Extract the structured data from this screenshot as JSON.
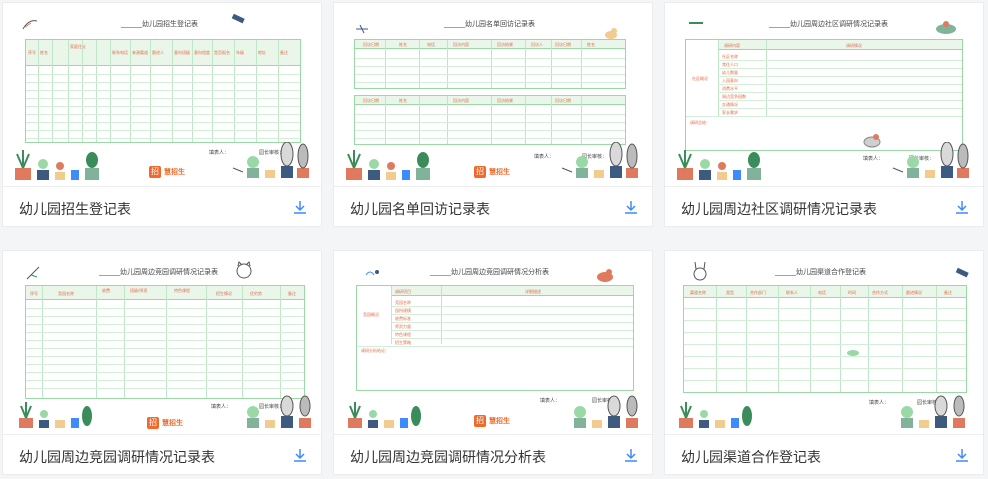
{
  "cards": [
    {
      "title": "幼儿园招生登记表",
      "doc_title": "______幼儿园招生登记表",
      "headers": [
        "序号",
        "姓名",
        "性别",
        "家庭住址",
        "联系电话",
        "来源渠道",
        "意向班级",
        "跟进人",
        "备注",
        "意向程度",
        "是否报名",
        "年级",
        "地址"
      ],
      "sig_left": "填表人：",
      "sig_right": "园长审核：",
      "brand": "慧招生"
    },
    {
      "title": "幼儿园名单回访记录表",
      "doc_title": "______幼儿园名单回访记录表",
      "headers": [
        "回访日期",
        "姓名",
        "电话",
        "回访内容",
        "回访结果",
        "回访人",
        "回访日期",
        "姓名",
        "电话",
        "回访内容"
      ],
      "sig_left": "填表人：",
      "sig_right": "园长审核：",
      "brand": "慧招生"
    },
    {
      "title": "幼儿园周边社区调研情况记录表",
      "doc_title": "______幼儿园周边社区调研情况记录表",
      "headers": [
        "调研内容",
        "调研情况"
      ],
      "rows": [
        "社区名称",
        "常住人口",
        "幼儿数量",
        "入园意向",
        "消费水平",
        "周边竞争园数",
        "交通情况",
        "家长需求",
        "其他"
      ],
      "side_label": "社区概况",
      "note_label": "调研总结：",
      "sig_left": "填表人：",
      "sig_right": "园长审核："
    },
    {
      "title": "幼儿园周边竞园调研情况记录表",
      "doc_title": "______幼儿园周边竞园调研情况记录表",
      "headers": [
        "序号",
        "竞园名称",
        "收费",
        "班级/师资",
        "特色课程",
        "招生情况",
        "优劣势",
        "备注"
      ],
      "sig_left": "填表人：",
      "sig_right": "园长审核：",
      "brand": "慧招生"
    },
    {
      "title": "幼儿园周边竞园调研情况分析表",
      "doc_title": "______幼儿园周边竞园调研情况分析表",
      "headers": [
        "调研项目",
        "详细描述"
      ],
      "rows": [
        "竞园名称",
        "园所规模",
        "收费标准",
        "师资力量",
        "特色课程",
        "招生策略"
      ],
      "side_label": "竞园概况",
      "note_label": "调研分析结论：",
      "sig_left": "填表人：",
      "sig_right": "园长审核：",
      "brand": "慧招生"
    },
    {
      "title": "幼儿园渠道合作登记表",
      "doc_title": "______幼儿园渠道合作登记表",
      "headers": [
        "渠道名称",
        "类型",
        "合作部门",
        "联系人",
        "电话",
        "时间",
        "合作方式",
        "跟进情况",
        "备注"
      ],
      "sig_left": "填表人：",
      "sig_right": "园长审核："
    }
  ],
  "icons": {
    "download": "download-icon"
  },
  "colors": {
    "table_border": "#9ad9a5",
    "header_bg": "#eaf6ea",
    "header_text": "#e06b4a",
    "brand": "#f06a2c",
    "download": "#3d8bfd"
  }
}
